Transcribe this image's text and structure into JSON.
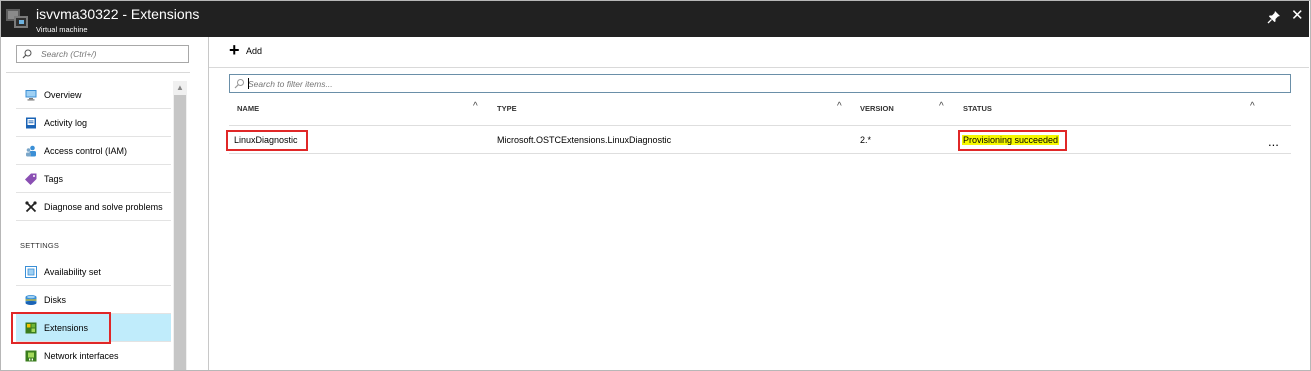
{
  "header": {
    "title": "isvvma30322 - Extensions",
    "subtitle": "Virtual machine",
    "close_glyph": "✕",
    "pin_icon": "pin-icon"
  },
  "sidebar": {
    "search_placeholder": "Search (Ctrl+/)",
    "scroll_up_glyph": "▲",
    "items": [
      {
        "label": "Overview",
        "icon": "monitor-icon"
      },
      {
        "label": "Activity log",
        "icon": "log-icon"
      },
      {
        "label": "Access control (IAM)",
        "icon": "users-icon"
      },
      {
        "label": "Tags",
        "icon": "tag-icon"
      },
      {
        "label": "Diagnose and solve problems",
        "icon": "wrench-icon"
      }
    ],
    "section_label": "SETTINGS",
    "settings_items": [
      {
        "label": "Availability set",
        "icon": "availability-set-icon"
      },
      {
        "label": "Disks",
        "icon": "disk-icon"
      },
      {
        "label": "Extensions",
        "icon": "extensions-icon",
        "active": true
      },
      {
        "label": "Network interfaces",
        "icon": "network-interface-icon"
      }
    ]
  },
  "toolbar": {
    "add_glyph": "+",
    "add_label": "Add"
  },
  "filter": {
    "placeholder": "Search to filter items..."
  },
  "table": {
    "columns": [
      {
        "label": "NAME",
        "sort_glyph": "^"
      },
      {
        "label": "TYPE",
        "sort_glyph": "^"
      },
      {
        "label": "VERSION",
        "sort_glyph": "^"
      },
      {
        "label": "STATUS",
        "sort_glyph": "^"
      }
    ],
    "rows": [
      {
        "name": "LinuxDiagnostic",
        "type": "Microsoft.OSTCExtensions.LinuxDiagnostic",
        "version": "2.*",
        "status": "Provisioning succeeded",
        "more": "..."
      }
    ]
  },
  "colors": {
    "header_bg": "#212121",
    "active_item_bg": "#c0ecfb",
    "highlight_border": "#e02727",
    "status_highlight": "#f5f900"
  }
}
